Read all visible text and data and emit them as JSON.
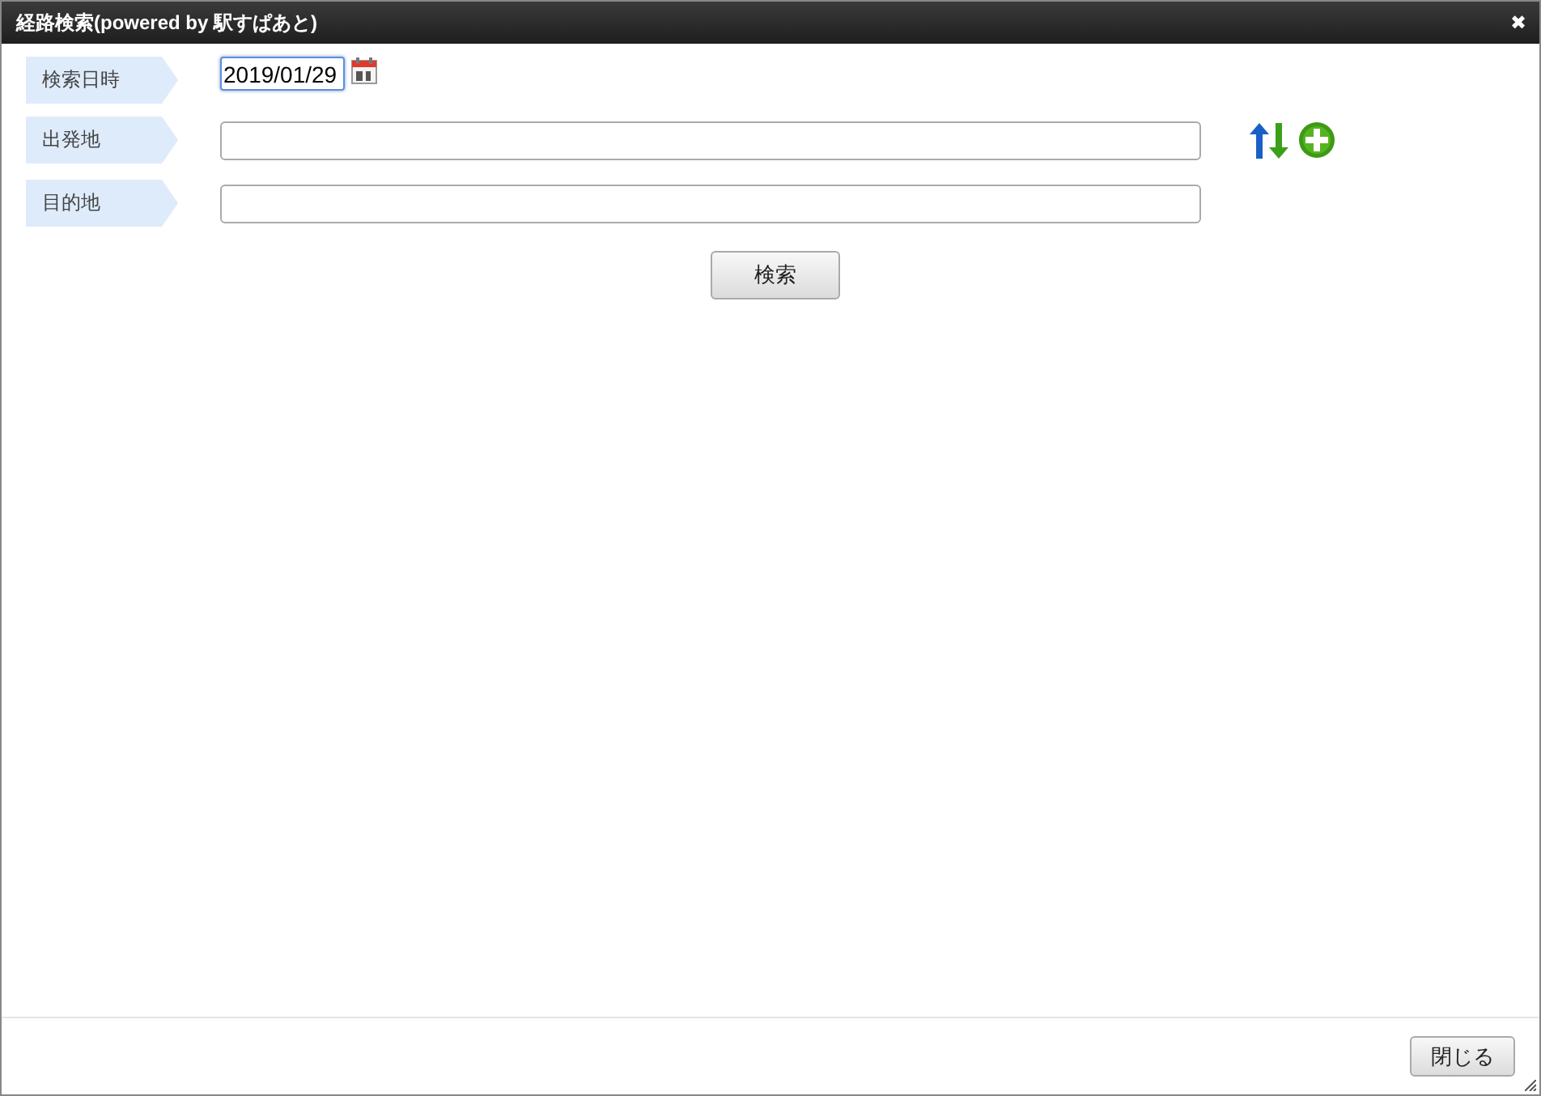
{
  "window": {
    "title": "経路検索(powered by 駅すぱあと)",
    "close": "✖"
  },
  "fields": [
    {
      "label": "検索日時",
      "kind": "date",
      "value": "2019/01/29",
      "focused": true
    },
    {
      "label": "出発地",
      "kind": "text",
      "focused": false
    },
    {
      "label": "目的地",
      "kind": "text",
      "focused": false
    }
  ],
  "search_button": "検索",
  "footer": {
    "close_button": "閉じる"
  }
}
